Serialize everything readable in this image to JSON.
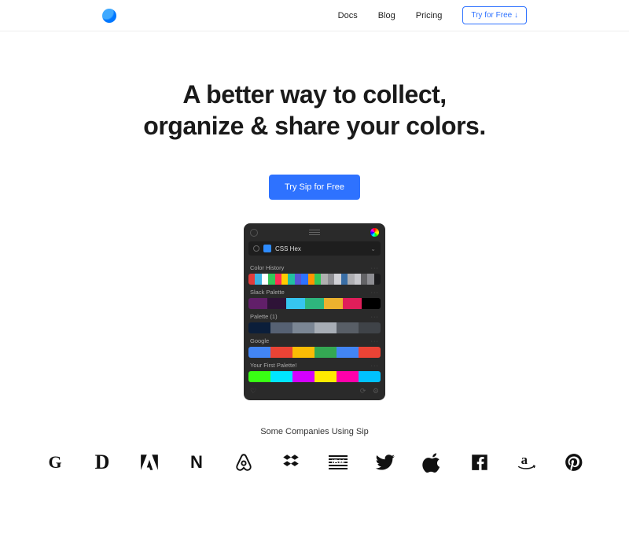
{
  "header": {
    "nav": {
      "docs": "Docs",
      "blog": "Blog",
      "pricing": "Pricing"
    },
    "try_button": "Try for Free ↓"
  },
  "hero": {
    "title_line1": "A better way to collect,",
    "title_line2": "organize & share your colors.",
    "cta": "Try Sip for Free"
  },
  "app": {
    "format_label": "CSS Hex",
    "sections": {
      "history": {
        "label": "Color History",
        "colors": [
          "#e13c3c",
          "#3cb2e1",
          "#ffffff",
          "#34c759",
          "#ff2d55",
          "#ffcc00",
          "#22c0a0",
          "#5856d6",
          "#2e72ff",
          "#ff9500",
          "#34c759",
          "#b0b0b0",
          "#8e8e93",
          "#d1d1d6",
          "#3a6ea5",
          "#aeaeb2",
          "#c7c7cc",
          "#636366",
          "#8e8e93",
          "#1c1c1e"
        ]
      },
      "slack": {
        "label": "Slack Palette",
        "colors": [
          "#611f69",
          "#2e1337",
          "#36c5f0",
          "#2eb67d",
          "#ecb22e",
          "#e01e5a",
          "#000000"
        ]
      },
      "palette1": {
        "label": "Palette (1)",
        "colors": [
          "#0b1e3a",
          "#566173",
          "#7b8694",
          "#a7adb5",
          "#585e66",
          "#3f4348"
        ]
      },
      "google": {
        "label": "Google",
        "colors": [
          "#4285f4",
          "#ea4335",
          "#fbbc05",
          "#34a853",
          "#4285f4",
          "#ea4335"
        ]
      },
      "first": {
        "label": "Your First Palette!",
        "colors": [
          "#39ff14",
          "#00e5ff",
          "#d400ff",
          "#ffea00",
          "#ff00aa",
          "#00c2ff"
        ]
      }
    }
  },
  "companies": {
    "label": "Some Companies Using Sip",
    "items": [
      {
        "name": "google"
      },
      {
        "name": "disney"
      },
      {
        "name": "adobe"
      },
      {
        "name": "netflix"
      },
      {
        "name": "airbnb"
      },
      {
        "name": "dropbox"
      },
      {
        "name": "ibm"
      },
      {
        "name": "twitter"
      },
      {
        "name": "apple"
      },
      {
        "name": "facebook"
      },
      {
        "name": "amazon"
      },
      {
        "name": "pinterest"
      }
    ]
  }
}
